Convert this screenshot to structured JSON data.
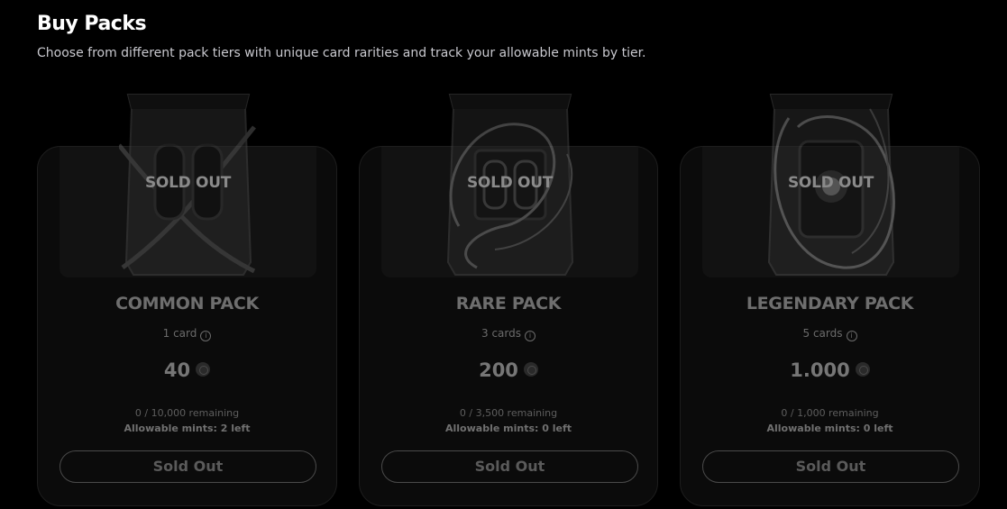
{
  "header": {
    "title": "Buy Packs",
    "subtitle": "Choose from different pack tiers with unique card rarities and track your allowable mints by tier."
  },
  "packs": [
    {
      "overlay": "SOLD OUT",
      "name": "COMMON PACK",
      "cards": "1 card",
      "price": "40",
      "remaining": "0 / 10,000 remaining",
      "allowable": "Allowable mints: 2 left",
      "button": "Sold Out",
      "art_icon": "chained-pack-icon"
    },
    {
      "overlay": "SOLD OUT",
      "name": "RARE PACK",
      "cards": "3 cards",
      "price": "200",
      "remaining": "0 / 3,500 remaining",
      "allowable": "Allowable mints: 0 left",
      "button": "Sold Out",
      "art_icon": "swirl-pack-icon"
    },
    {
      "overlay": "SOLD OUT",
      "name": "LEGENDARY PACK",
      "cards": "5 cards",
      "price": "1.000",
      "remaining": "0 / 1,000 remaining",
      "allowable": "Allowable mints: 0 left",
      "button": "Sold Out",
      "art_icon": "glowing-pack-icon"
    }
  ],
  "colors": {
    "background": "#000000",
    "card_bg": "#0b0b0b",
    "muted_text": "#6e6e6e"
  }
}
